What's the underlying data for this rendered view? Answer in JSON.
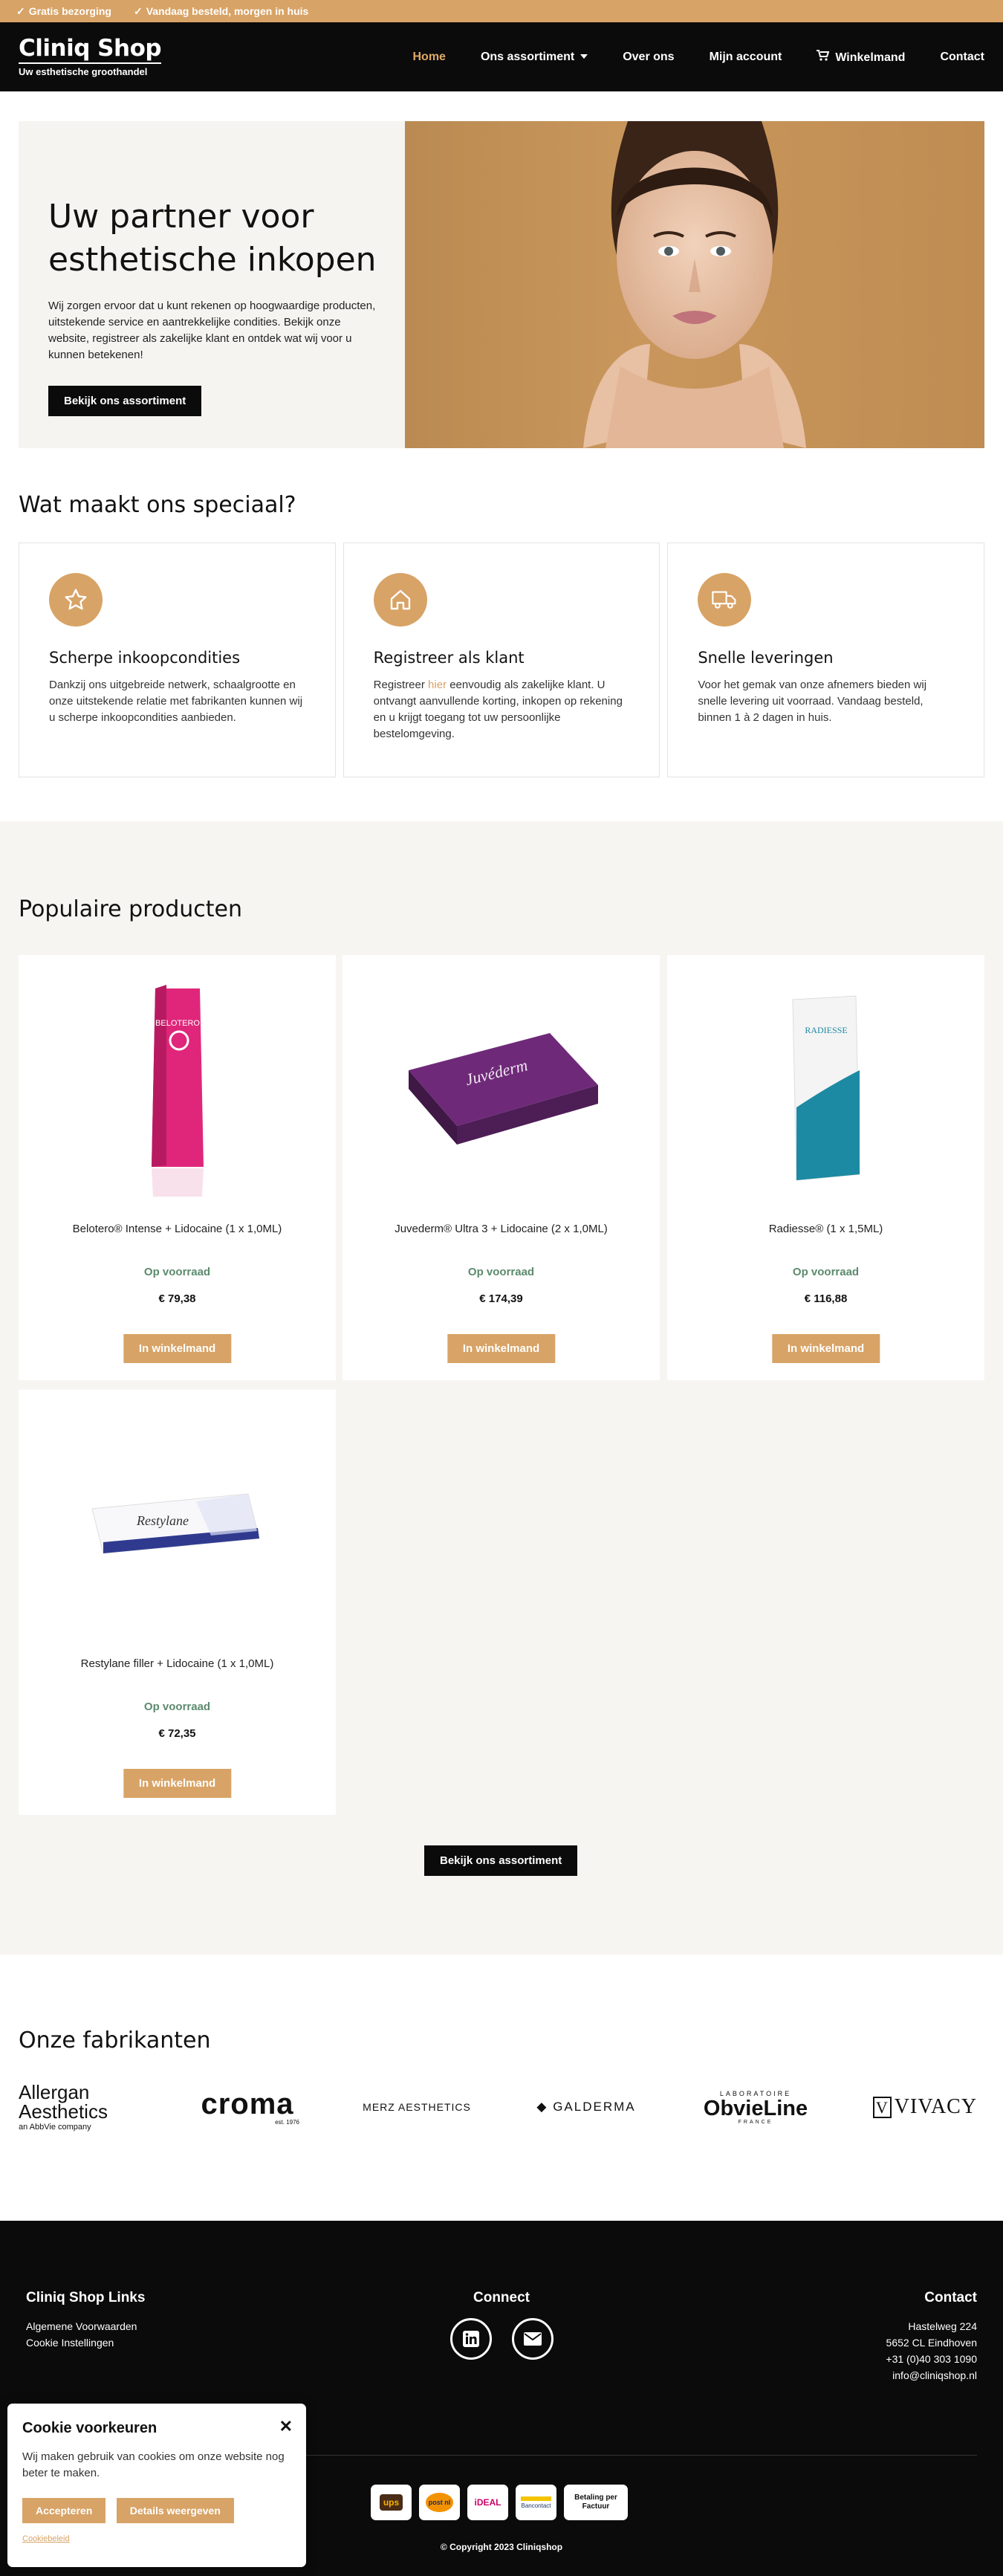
{
  "topbar": {
    "items": [
      "Gratis bezorging",
      "Vandaag besteld, morgen in huis"
    ]
  },
  "header": {
    "logo_name": "Cliniq Shop",
    "logo_tagline": "Uw esthetische groothandel",
    "nav": {
      "home": "Home",
      "assortiment": "Ons assortiment",
      "over": "Over ons",
      "account": "Mijn account",
      "winkelmand": "Winkelmand",
      "contact": "Contact"
    }
  },
  "hero": {
    "title": "Uw partner voor esthetische inkopen",
    "text": "Wij zorgen ervoor dat u kunt rekenen op hoogwaardige producten, uitstekende service en aantrekkelijke condities. Bekijk onze website, registreer als zakelijke klant en ontdek wat wij voor u kunnen betekenen!",
    "button": "Bekijk ons assortiment"
  },
  "special": {
    "heading": "Wat maakt ons speciaal?",
    "features": [
      {
        "icon": "star-icon",
        "title": "Scherpe inkoopcondities",
        "text": "Dankzij ons uitgebreide netwerk, schaalgrootte en onze uitstekende relatie met fabrikanten kunnen wij u scherpe inkoopcondities aanbieden."
      },
      {
        "icon": "house-icon",
        "title": "Registreer als klant",
        "text_before": "Registreer ",
        "text_link": "hier",
        "text_after": " eenvoudig als zakelijke klant. U ontvangt aanvullende korting, inkopen op rekening en u krijgt toegang tot uw persoonlijke bestelomgeving."
      },
      {
        "icon": "truck-icon",
        "title": "Snelle leveringen",
        "text": "Voor het gemak van onze afnemers bieden wij snelle levering uit voorraad. Vandaag besteld, binnen 1 à 2 dagen in huis."
      }
    ]
  },
  "products": {
    "heading": "Populaire producten",
    "items": [
      {
        "name": "Belotero® Intense + Lidocaine (1 x 1,0ML)",
        "stock": "Op voorraad",
        "price": "€ 79,38",
        "button": "In winkelmand",
        "box_label": "BELOTERO"
      },
      {
        "name": "Juvederm® Ultra 3 + Lidocaine (2 x 1,0ML)",
        "stock": "Op voorraad",
        "price": "€ 174,39",
        "button": "In winkelmand",
        "box_label": "Juvéderm"
      },
      {
        "name": "Radiesse® (1 x 1,5ML)",
        "stock": "Op voorraad",
        "price": "€ 116,88",
        "button": "In winkelmand",
        "box_label": "RADIESSE"
      },
      {
        "name": "Restylane filler + Lidocaine (1 x 1,0ML)",
        "stock": "Op voorraad",
        "price": "€ 72,35",
        "button": "In winkelmand",
        "box_label": "Restylane"
      }
    ],
    "all_button": "Bekijk ons assortiment"
  },
  "manufacturers": {
    "heading": "Onze fabrikanten",
    "logos": {
      "allergan": {
        "line1": "Allergan",
        "line2": "Aesthetics",
        "line3": "an AbbVie company"
      },
      "croma": {
        "line1": "croma",
        "line2": "est. 1976"
      },
      "merz": {
        "line1": "MERZ AESTHETICS"
      },
      "galderma": {
        "line1": "GALDERMA"
      },
      "obvieline": {
        "line1": "LABORATOIRE",
        "line2": "ObvieLine",
        "line3": "FRANCE"
      },
      "vivacy": {
        "line1": "VIVACY"
      }
    }
  },
  "footer": {
    "links_title": "Cliniq Shop Links",
    "links": [
      "Algemene Voorwaarden",
      "Cookie Instellingen"
    ],
    "connect_title": "Connect",
    "contact_title": "Contact",
    "contact": [
      "Hastelweg 224",
      "5652 CL Eindhoven",
      "+31 (0)40 303 1090",
      "info@cliniqshop.nl"
    ],
    "payments": {
      "ups": "ups",
      "postnl": "post nl",
      "ideal": "iDEAL",
      "bancontact": "Bancontact",
      "factuur": "Betaling per Factuur"
    },
    "copyright": "© Copyright 2023 Cliniqshop"
  },
  "cookie": {
    "title": "Cookie voorkeuren",
    "text": "Wij maken gebruik van cookies om onze website nog beter te maken.",
    "accept": "Accepteren",
    "details": "Details weergeven",
    "policy": "Cookiebeleid"
  },
  "colors": {
    "accent": "#d8a366",
    "dark": "#0b0b0b",
    "stock_green": "#5c8a6d",
    "section_bg": "#f7f5f2"
  }
}
